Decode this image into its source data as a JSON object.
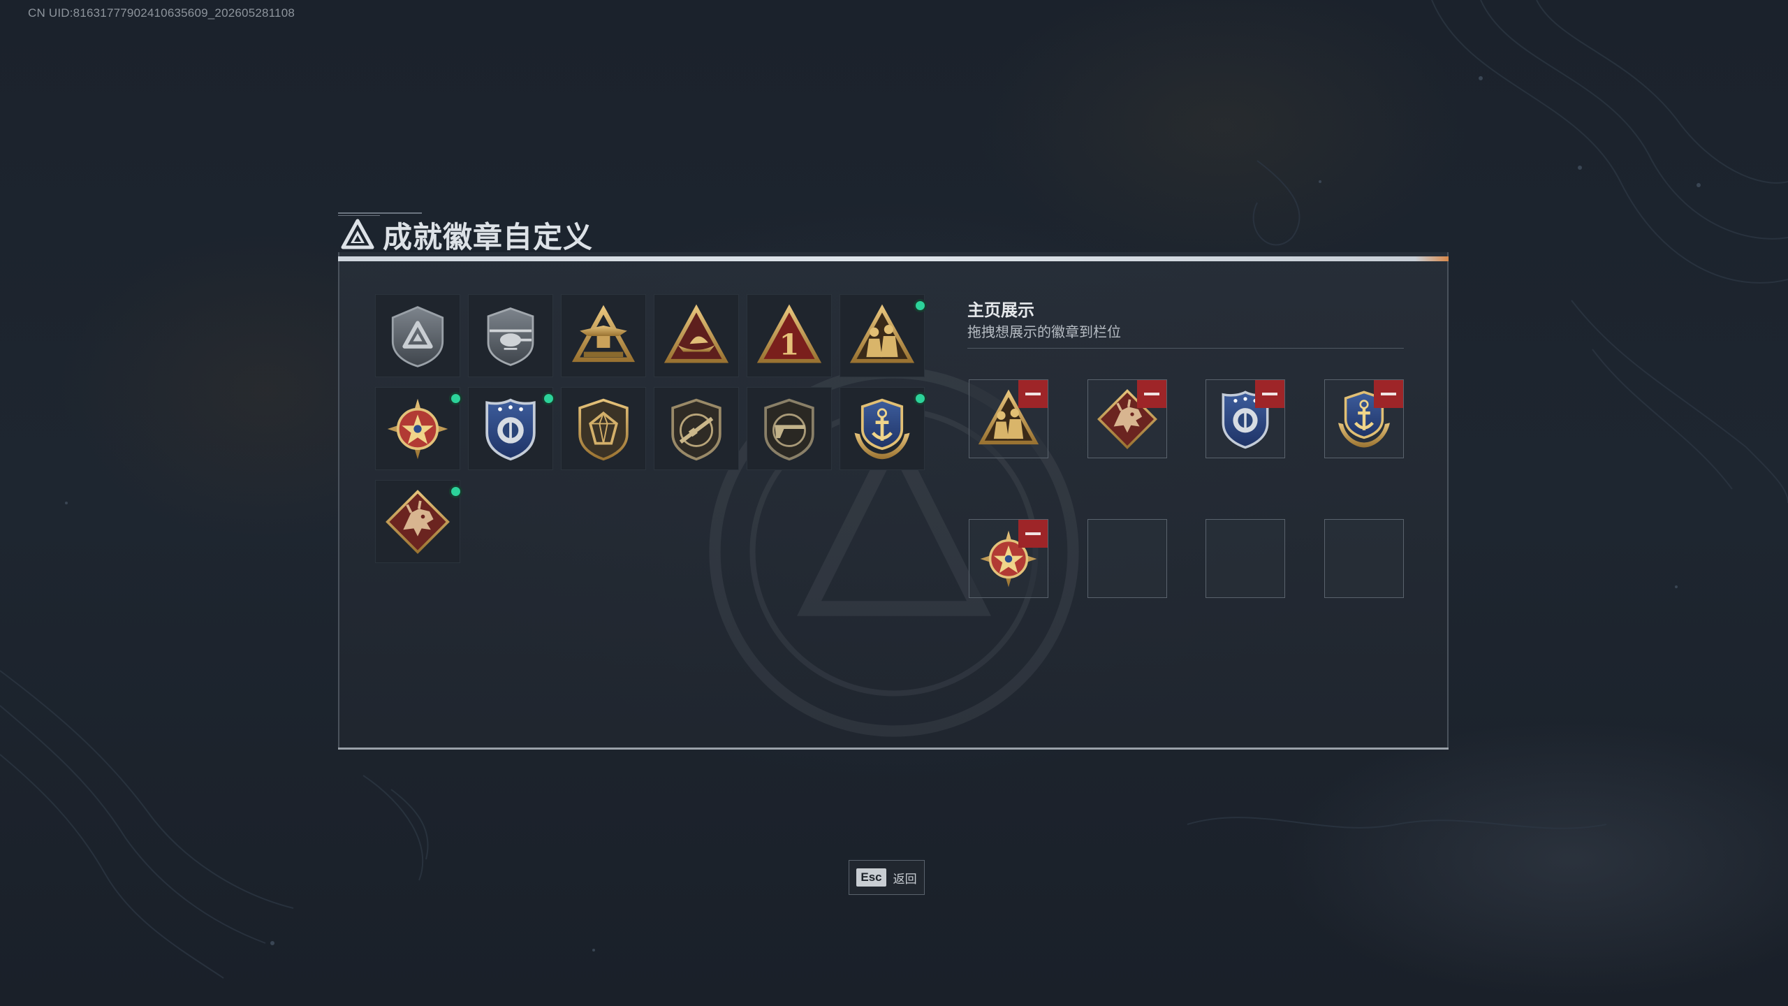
{
  "uid_text": "CN UID:8163177790241063​5609_202605281108",
  "title": "成就徽章自定义",
  "showcase": {
    "title": "主页展示",
    "subtitle": "拖拽想展示的徽章到栏位"
  },
  "badges": [
    {
      "icon": "shield-delta-icon",
      "new": false
    },
    {
      "icon": "helicopter-shield-icon",
      "new": false
    },
    {
      "icon": "winged-triangle-icon",
      "new": false
    },
    {
      "icon": "ship-triangle-icon",
      "new": false
    },
    {
      "icon": "number-one-triangle-icon",
      "new": false
    },
    {
      "icon": "soldiers-triangle-icon",
      "new": true
    },
    {
      "icon": "star-compass-icon",
      "new": true
    },
    {
      "icon": "blue-police-shield-icon",
      "new": true
    },
    {
      "icon": "gem-shield-icon",
      "new": false
    },
    {
      "icon": "rifle-shield-icon",
      "new": false
    },
    {
      "icon": "rifle-shield-dark-icon",
      "new": false
    },
    {
      "icon": "anchor-crest-icon",
      "new": true
    },
    {
      "icon": "dragon-diamond-icon",
      "new": true
    }
  ],
  "slots": [
    {
      "icon": "soldiers-triangle-icon",
      "filled": true
    },
    {
      "icon": "dragon-diamond-icon",
      "filled": true
    },
    {
      "icon": "blue-police-shield-icon",
      "filled": true
    },
    {
      "icon": "anchor-crest-icon",
      "filled": true
    },
    {
      "icon": "star-compass-icon",
      "filled": true
    },
    {
      "icon": "",
      "filled": false
    },
    {
      "icon": "",
      "filled": false
    },
    {
      "icon": "",
      "filled": false
    }
  ],
  "esc": {
    "key": "Esc",
    "label": "返回"
  },
  "colors": {
    "new_dot": "#2cd39a",
    "remove_button": "#9e2528",
    "gold": "#c9a04e",
    "accent_orange": "#d8884a"
  }
}
